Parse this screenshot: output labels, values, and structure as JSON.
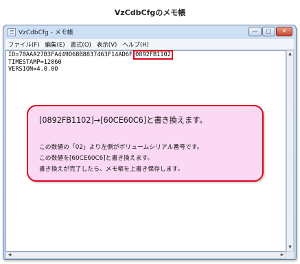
{
  "caption": "VzCdbCfgのメモ帳",
  "window": {
    "title": "VzCdbCfg - メモ帳",
    "buttons": {
      "minimize": "—",
      "maximize": "□",
      "close": "✕"
    }
  },
  "menu": [
    "ファイル(F)",
    "編集(E)",
    "書式(O)",
    "表示(V)",
    "ヘルプ(H)"
  ],
  "file_lines": {
    "id_prefix": "ID=70AAA27B3FA449D68B8837463F14AD6F",
    "id_highlight": "0892FB1102",
    "timestamp": "TIMESTAMP=12060",
    "version": "VERSION=4.0.00"
  },
  "callout": {
    "heading": "[0892FB1102]→[60CE60C6]と書き換えます。",
    "lines": [
      "この数値の「02」より左側がボリュームシリアル番号です。",
      "この数値を[60CE60C6]と書き換えます。",
      "書き換えが完了したら、メモ帳を上書き保存します。"
    ]
  },
  "colors": {
    "highlight_border": "#e2001a",
    "callout_fill": "#fbd9f4"
  }
}
